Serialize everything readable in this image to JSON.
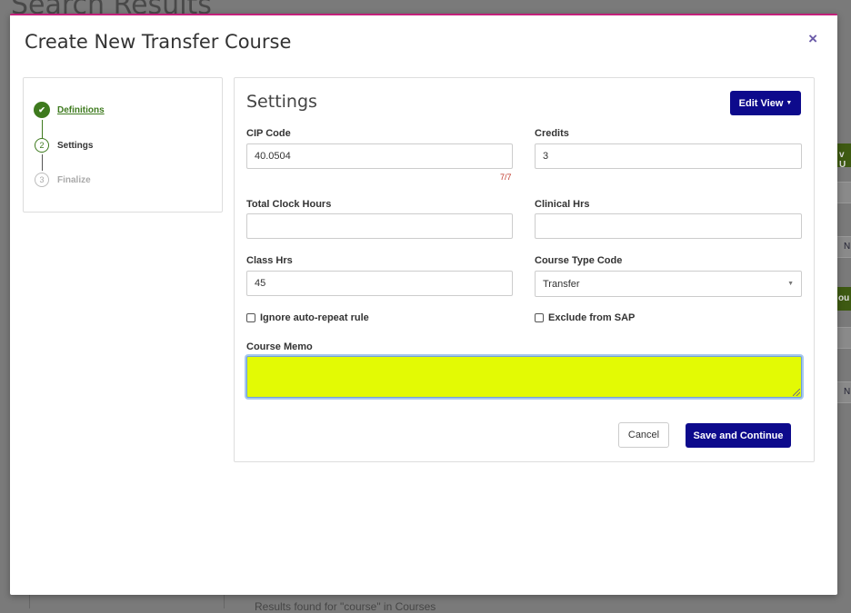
{
  "background": {
    "title": "Search Results",
    "footer_text": "Results found for \"course\" in Courses",
    "side_fragments": [
      "v U",
      "N",
      "ou",
      "N"
    ]
  },
  "modal": {
    "title": "Create New Transfer Course",
    "close_symbol": "×",
    "accent_color": "#c2207a"
  },
  "steps": [
    {
      "number": "✔",
      "label": "Definitions",
      "state": "complete"
    },
    {
      "number": "2",
      "label": "Settings",
      "state": "active"
    },
    {
      "number": "3",
      "label": "Finalize",
      "state": "pending"
    }
  ],
  "settings": {
    "title": "Settings",
    "edit_view_label": "Edit View",
    "fields": {
      "cip_code": {
        "label": "CIP Code",
        "value": "40.0504",
        "counter": "7/7"
      },
      "credits": {
        "label": "Credits",
        "value": "3"
      },
      "total_clock_hours": {
        "label": "Total Clock Hours",
        "value": ""
      },
      "clinical_hrs": {
        "label": "Clinical Hrs",
        "value": ""
      },
      "class_hrs": {
        "label": "Class Hrs",
        "value": "45"
      },
      "course_type_code": {
        "label": "Course Type Code",
        "value": "Transfer"
      },
      "ignore_auto_repeat": {
        "label": "Ignore auto-repeat rule",
        "checked": false
      },
      "exclude_from_sap": {
        "label": "Exclude from SAP",
        "checked": false
      },
      "course_memo": {
        "label": "Course Memo",
        "value": "",
        "highlight_color": "#e3fa04"
      }
    },
    "cancel_label": "Cancel",
    "save_label": "Save and Continue",
    "primary_color": "#0d0a8c"
  }
}
